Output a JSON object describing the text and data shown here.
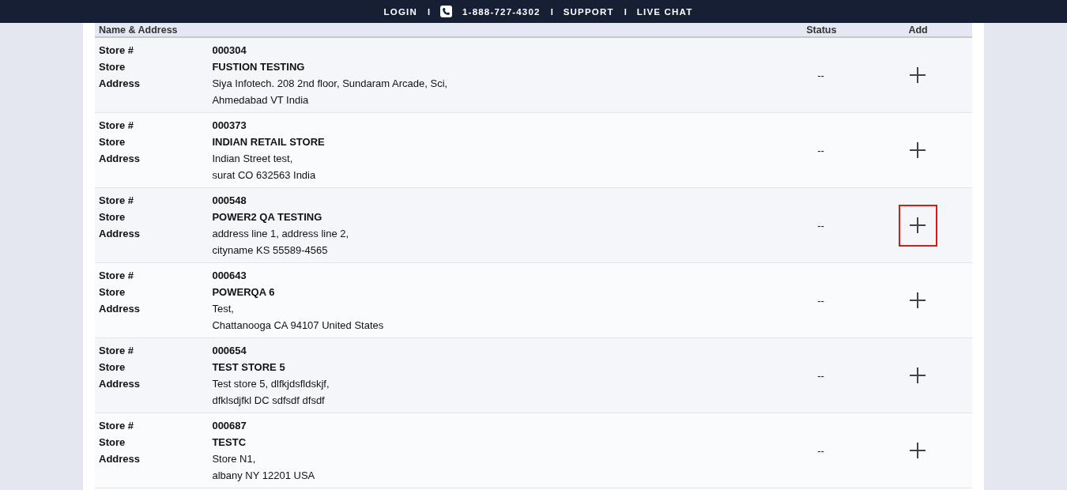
{
  "top_bar": {
    "items": [
      {
        "kind": "link",
        "label": "LOGIN"
      },
      {
        "kind": "separator",
        "label": "I"
      },
      {
        "kind": "phone",
        "label": "1-888-727-4302"
      },
      {
        "kind": "separator",
        "label": "I"
      },
      {
        "kind": "link",
        "label": "SUPPORT"
      },
      {
        "kind": "separator",
        "label": "I"
      },
      {
        "kind": "link",
        "label": "LIVE CHAT"
      }
    ]
  },
  "table": {
    "columns": [
      "Name & Address",
      "Status",
      "Add"
    ],
    "rows": [
      {
        "labels": [
          "Store #",
          "Store",
          "Address"
        ],
        "store_number": "000304",
        "store_name": "FUSTION TESTING",
        "address_lines": [
          "Siya Infotech. 208 2nd floor, Sundaram Arcade, Sci,",
          "Ahmedabad VT India"
        ],
        "status": "--",
        "highlighted": false
      },
      {
        "labels": [
          "Store #",
          "Store",
          "Address"
        ],
        "store_number": "000373",
        "store_name": "INDIAN RETAIL STORE",
        "address_lines": [
          "Indian Street test,",
          "surat CO 632563 India"
        ],
        "status": "--",
        "highlighted": false
      },
      {
        "labels": [
          "Store #",
          "Store",
          "Address"
        ],
        "store_number": "000548",
        "store_name": "POWER2 QA TESTING",
        "address_lines": [
          "address line 1, address line 2,",
          "cityname KS 55589-4565"
        ],
        "status": "--",
        "highlighted": true
      },
      {
        "labels": [
          "Store #",
          "Store",
          "Address"
        ],
        "store_number": "000643",
        "store_name": "POWERQA 6",
        "address_lines": [
          "Test,",
          "Chattanooga CA 94107 United States"
        ],
        "status": "--",
        "highlighted": false
      },
      {
        "labels": [
          "Store #",
          "Store",
          "Address"
        ],
        "store_number": "000654",
        "store_name": "TEST STORE 5",
        "address_lines": [
          "Test store 5, dlfkjdsfldskjf,",
          "dfklsdjfkl DC sdfsdf dfsdf"
        ],
        "status": "--",
        "highlighted": false
      },
      {
        "labels": [
          "Store #",
          "Store",
          "Address"
        ],
        "store_number": "000687",
        "store_name": "TESTC",
        "address_lines": [
          "Store N1,",
          "albany NY 12201 USA"
        ],
        "status": "--",
        "highlighted": false
      }
    ]
  }
}
